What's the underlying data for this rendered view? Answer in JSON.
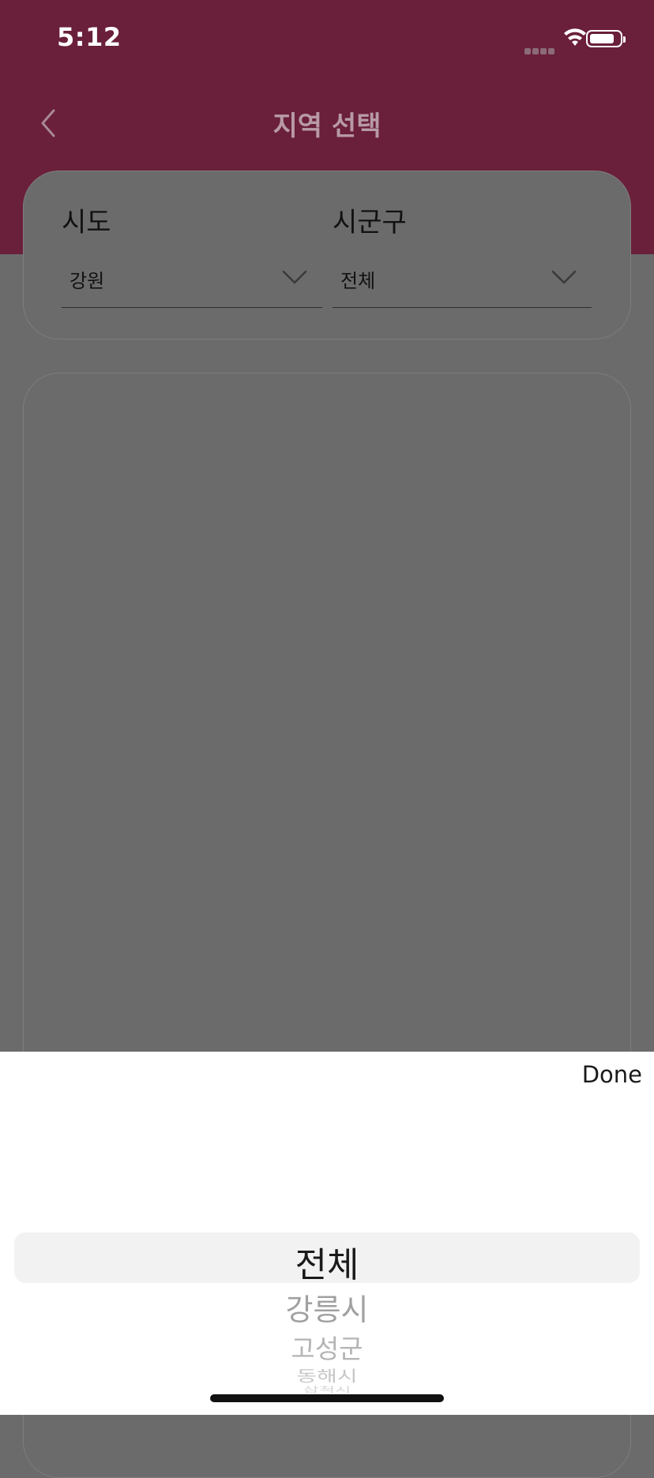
{
  "status_bar": {
    "time": "5:12"
  },
  "header": {
    "title": "지역 선택"
  },
  "selector": {
    "sido": {
      "label": "시도",
      "value": "강원"
    },
    "sigungu": {
      "label": "시군구",
      "value": "전체"
    }
  },
  "picker": {
    "done_label": "Done",
    "selected": "전체",
    "options": [
      "강릉시",
      "고성군",
      "동해시",
      "삼척시"
    ]
  },
  "colors": {
    "header_background": "#6a1f3a",
    "overlay_dim": "#6b6b6b"
  }
}
